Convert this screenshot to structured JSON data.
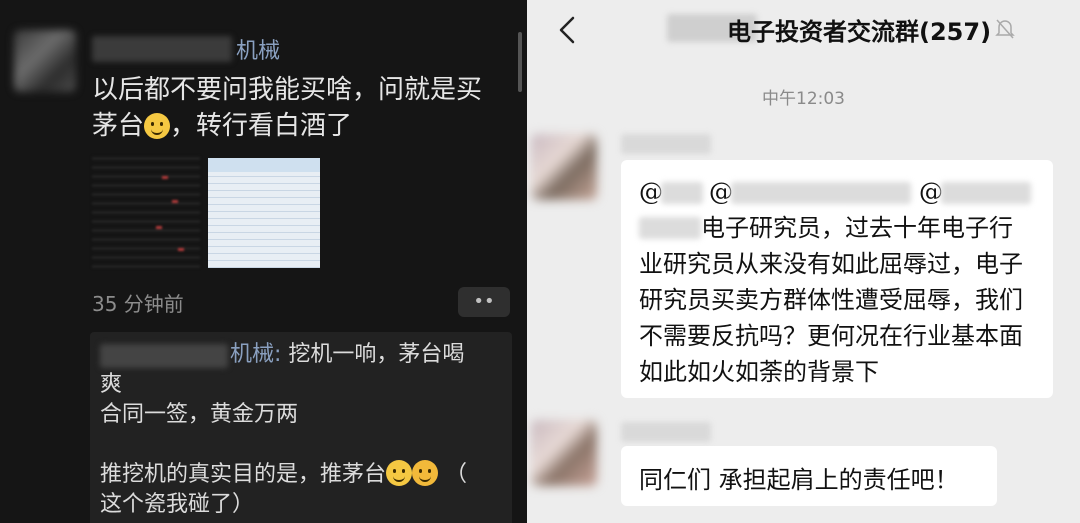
{
  "left": {
    "sender_suffix": "机械",
    "message_lines": [
      "以后都不要问我能买啥，问就是买",
      "茅台",
      "，转行看白酒了"
    ],
    "time": "35 分钟前",
    "more_label": "••",
    "comment": {
      "name_suffix": "机械",
      "line1": "挖机一响，茅台喝",
      "line2": "爽",
      "line3": "合同一签，黄金万两",
      "line4": "推挖机的真实目的是，推茅台",
      "line4_end": "（",
      "line5": "这个瓷我碰了）"
    }
  },
  "right": {
    "title": "电子投资者交流群(257)",
    "timestamp": "中午12:03",
    "message1": {
      "at_symbol": "@",
      "lines": [
        "电子研究员，过去十年电子行",
        "业研究员从来没有如此屈辱过，电子",
        "研究员买卖方群体性遭受屈辱，我们",
        "不需要反抗吗？更何况在行业基本面",
        "如此如火如荼的背景下"
      ]
    },
    "message2": "同仁们 承担起肩上的责任吧！"
  }
}
